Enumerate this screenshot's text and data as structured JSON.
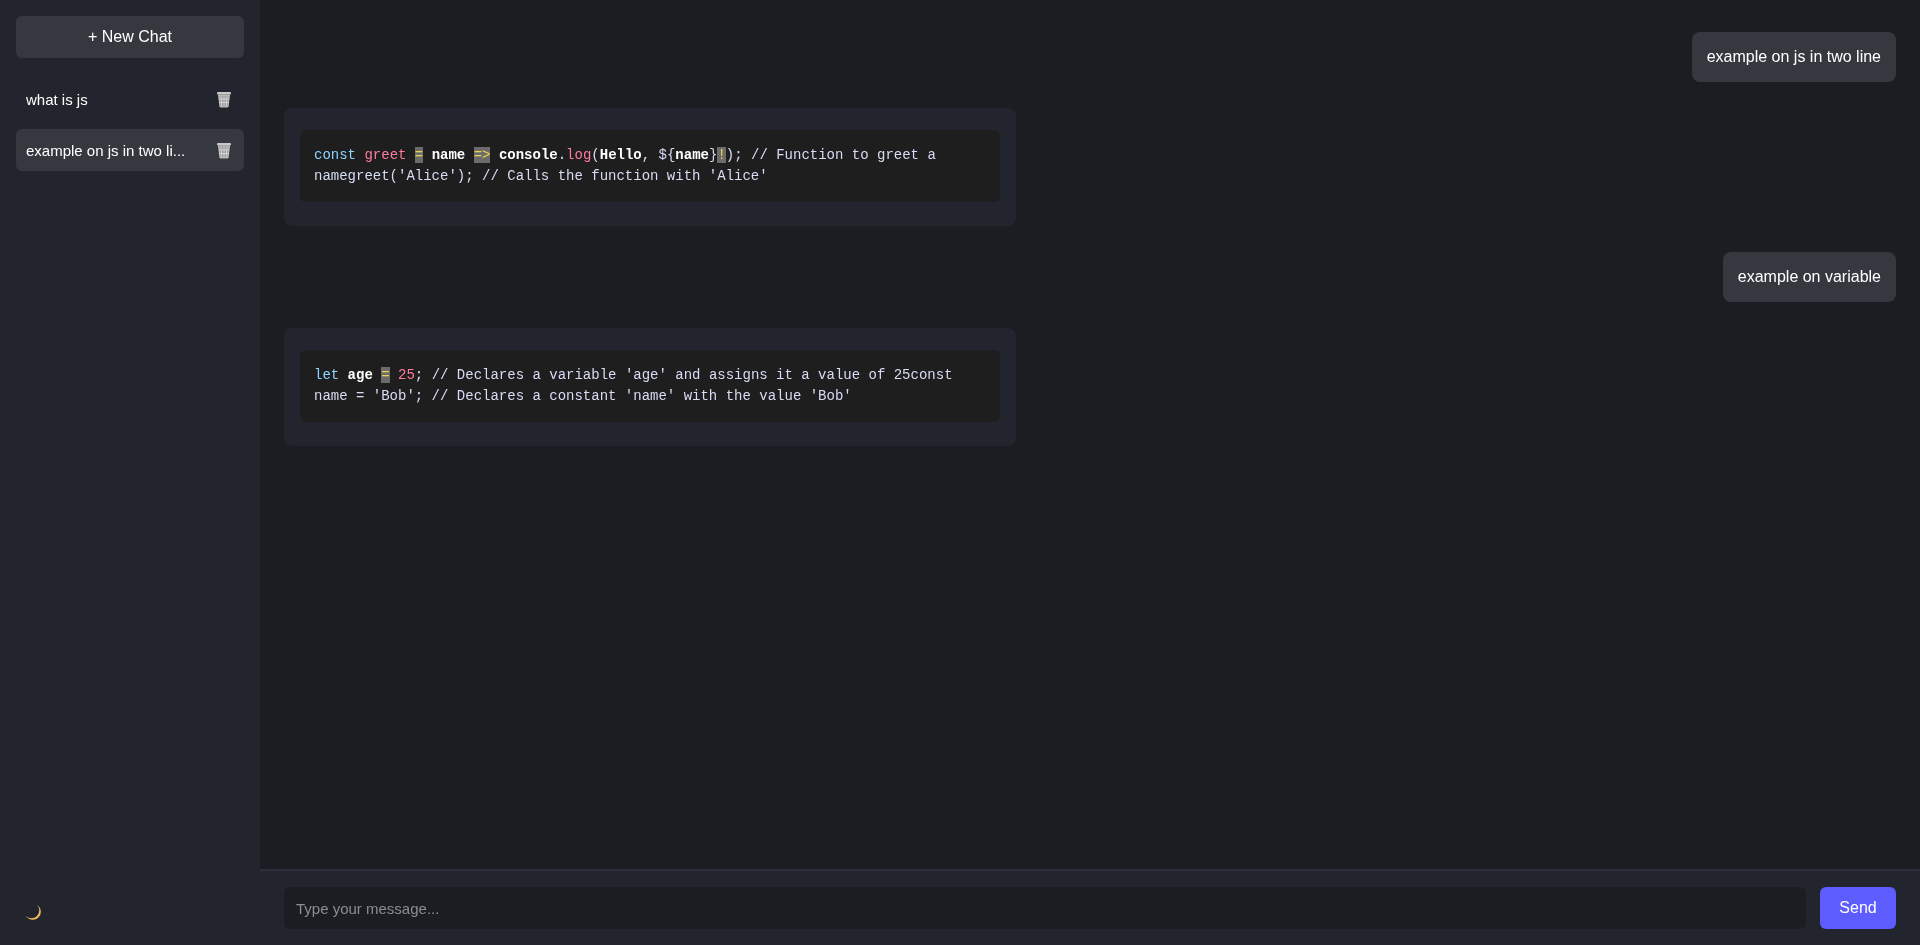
{
  "sidebar": {
    "new_chat_button": "+ New Chat",
    "items": [
      {
        "label": "what is js",
        "selected": false
      },
      {
        "label": "example on js in two li...",
        "selected": true
      }
    ]
  },
  "messages": [
    {
      "kind": "user",
      "text": "example on js in two line"
    },
    {
      "kind": "code",
      "tokens": [
        {
          "kind": "keyword",
          "text": "const "
        },
        {
          "kind": "variable",
          "text": "greet "
        },
        {
          "kind": "error",
          "text": "="
        },
        {
          "kind": "bold",
          "text": " name "
        },
        {
          "kind": "error",
          "text": "=>"
        },
        {
          "kind": "bold",
          "text": " console"
        },
        {
          "kind": "plain",
          "text": "."
        },
        {
          "kind": "variable",
          "text": "log"
        },
        {
          "kind": "plain",
          "text": "("
        },
        {
          "kind": "bold",
          "text": "Hello"
        },
        {
          "kind": "plain",
          "text": ", ${"
        },
        {
          "kind": "bold",
          "text": "name"
        },
        {
          "kind": "plain",
          "text": "}"
        },
        {
          "kind": "error",
          "text": "!"
        },
        {
          "kind": "plain",
          "text": "); // Function to greet a namegreet('Alice'); // Calls the function with 'Alice'"
        }
      ]
    },
    {
      "kind": "user",
      "text": "example on variable"
    },
    {
      "kind": "code",
      "tokens": [
        {
          "kind": "keyword",
          "text": "let "
        },
        {
          "kind": "bold",
          "text": "age "
        },
        {
          "kind": "error",
          "text": "="
        },
        {
          "kind": "variable",
          "text": " 25"
        },
        {
          "kind": "plain",
          "text": "; // Declares a variable 'age' and assigns it a value of 25const name = 'Bob'; // Declares a constant 'name' with the value 'Bob'"
        }
      ]
    }
  ],
  "composer": {
    "placeholder": "Type your message...",
    "send_button": "Send"
  }
}
